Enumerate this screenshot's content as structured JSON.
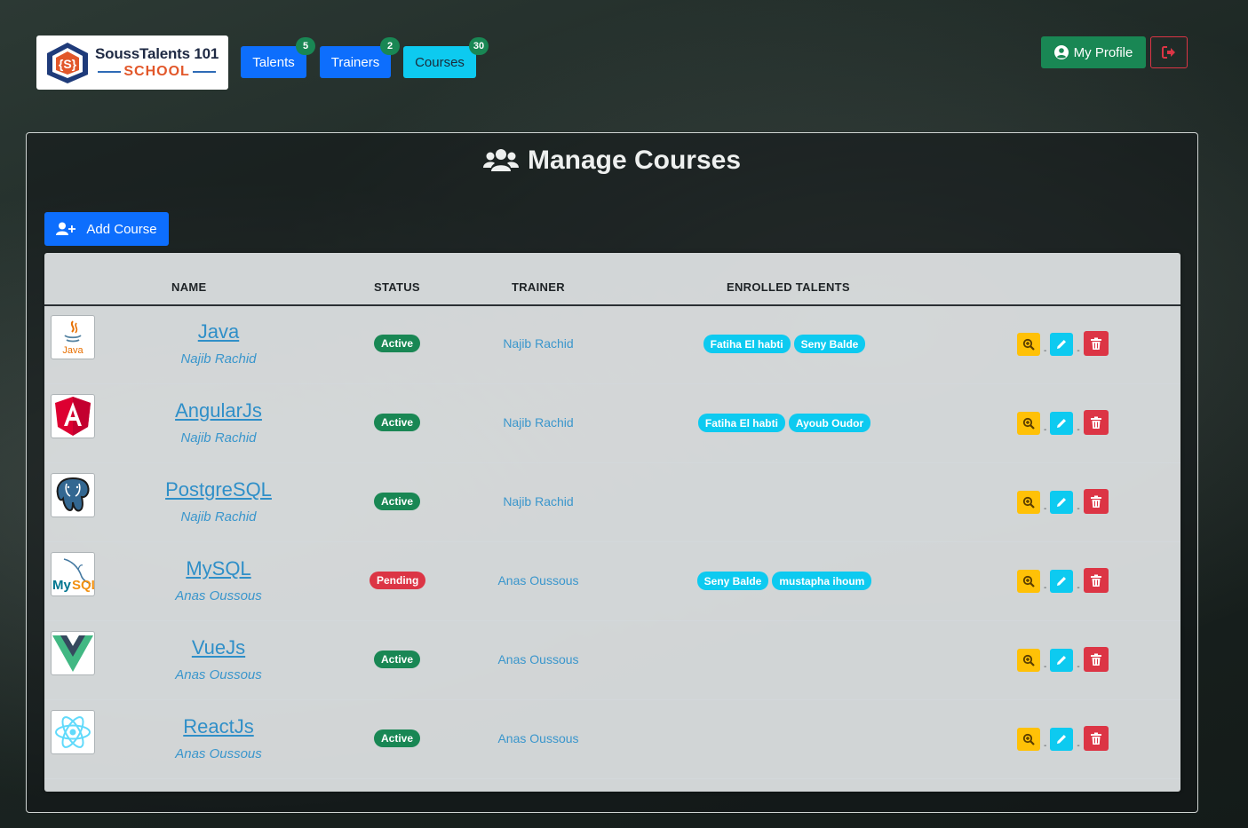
{
  "brand": {
    "title": "SoussTalents 101",
    "subtitle": "SCHOOL"
  },
  "nav": [
    {
      "label": "Talents",
      "count": "5"
    },
    {
      "label": "Trainers",
      "count": "2"
    },
    {
      "label": "Courses",
      "count": "30"
    }
  ],
  "profile": {
    "label": "My Profile",
    "icon": "user-circle-icon"
  },
  "logout": {
    "icon": "sign-out-icon",
    "color": "#dc3545"
  },
  "page": {
    "title": "Manage Courses",
    "icon": "users-icon"
  },
  "add_course": {
    "label": "Add Course",
    "icon": "user-plus-icon"
  },
  "table": {
    "headers": {
      "name": "NAME",
      "status": "STATUS",
      "trainer": "TRAINER",
      "talents": "ENROLLED TALENTS"
    },
    "rows": [
      {
        "name": "Java",
        "trainer": "Najib Rachid",
        "status": "Active",
        "talents": [
          "Fatiha El habti",
          "Seny Balde"
        ],
        "logo": "java-logo-icon"
      },
      {
        "name": "AngularJs",
        "trainer": "Najib Rachid",
        "status": "Active",
        "talents": [
          "Fatiha El habti",
          "Ayoub Oudor"
        ],
        "logo": "angular-logo-icon"
      },
      {
        "name": "PostgreSQL",
        "trainer": "Najib Rachid",
        "status": "Active",
        "talents": [],
        "logo": "postgresql-logo-icon"
      },
      {
        "name": "MySQL",
        "trainer": "Anas Oussous",
        "status": "Pending",
        "talents": [
          "Seny Balde",
          "mustapha ihoum"
        ],
        "logo": "mysql-logo-icon"
      },
      {
        "name": "VueJs",
        "trainer": "Anas Oussous",
        "status": "Active",
        "talents": [],
        "logo": "vue-logo-icon"
      },
      {
        "name": "ReactJs",
        "trainer": "Anas Oussous",
        "status": "Active",
        "talents": [],
        "logo": "react-logo-icon"
      }
    ],
    "actions": [
      {
        "name": "view",
        "icon": "search-plus-icon",
        "color": "#ffc107"
      },
      {
        "name": "edit",
        "icon": "pencil-icon",
        "color": "#0dcaf0"
      },
      {
        "name": "delete",
        "icon": "trash-icon",
        "color": "#dc3545"
      }
    ],
    "separator": "-"
  },
  "colors": {
    "primary": "#0d6efd",
    "success": "#198754",
    "info": "#0dcaf0",
    "danger": "#dc3545",
    "warning": "#ffc107"
  }
}
